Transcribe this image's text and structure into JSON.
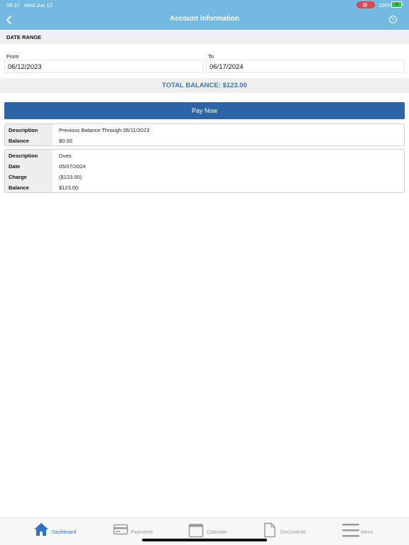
{
  "status_bar": {
    "time": "09:37",
    "date": "Wed Jun 12",
    "battery": "100%"
  },
  "header": {
    "title": "Account Information"
  },
  "date_range": {
    "heading": "DATE RANGE",
    "from_label": "From",
    "from_value": "06/12/2023",
    "to_label": "To",
    "to_value": "06/17/2024"
  },
  "total_balance": "TOTAL BALANCE: $123.00",
  "pay_now_label": "Pay Now",
  "records": [
    {
      "rows": [
        {
          "key": "Description",
          "value": "Previous Balance Through 06/11/2023"
        },
        {
          "key": "Balance",
          "value": "$0.00"
        }
      ]
    },
    {
      "rows": [
        {
          "key": "Description",
          "value": "Dues"
        },
        {
          "key": "Date",
          "value": "05/07/2024"
        },
        {
          "key": "Charge",
          "value": "($123.00)"
        },
        {
          "key": "Balance",
          "value": "$123.00"
        }
      ]
    }
  ],
  "tabbar": {
    "items": [
      {
        "label": "Dashboard",
        "icon": "home-icon",
        "active": true
      },
      {
        "label": "Payments",
        "icon": "credit-card-icon",
        "active": false
      },
      {
        "label": "Calendar",
        "icon": "calendar-icon",
        "active": false
      },
      {
        "label": "Documents",
        "icon": "document-icon",
        "active": false
      },
      {
        "label": "Menu",
        "icon": "menu-icon",
        "active": false
      }
    ]
  },
  "colors": {
    "header": "#73b9e1",
    "accent": "#2d64a6",
    "total_text": "#3c78b4",
    "active_tab": "#2e72c9",
    "inactive_tab": "#9a9a9a"
  }
}
